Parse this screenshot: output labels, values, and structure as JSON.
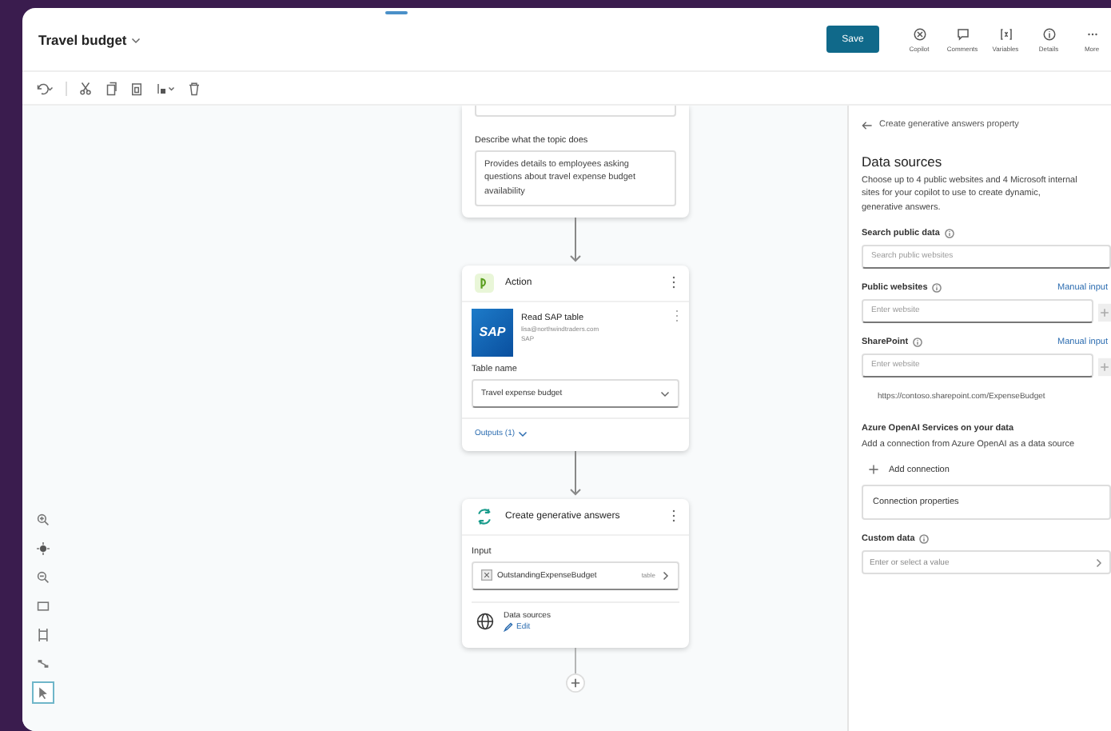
{
  "header": {
    "title": "Travel budget",
    "save": "Save",
    "tools": [
      {
        "kind": "copilot",
        "label": "Copilot"
      },
      {
        "kind": "comments",
        "label": "Comments"
      },
      {
        "kind": "variables",
        "label": "Variables"
      },
      {
        "kind": "details",
        "label": "Details"
      },
      {
        "kind": "more",
        "label": "More"
      }
    ]
  },
  "topic_card": {
    "description_label": "Describe what the topic does",
    "description": "Provides details to employees asking questions about travel expense budget availability"
  },
  "action_card": {
    "title": "Action",
    "logo": "SAP",
    "connector": "Read SAP table",
    "account": "lisa@northwindtraders.com",
    "detail": "SAP",
    "table_label": "Table name",
    "table_value": "Travel expense budget",
    "outputs": "Outputs (1)"
  },
  "generative_card": {
    "title": "Create generative answers",
    "input_label": "Input",
    "input_value": "OutstandingExpenseBudget",
    "input_type": "table",
    "data_sources": "Data sources",
    "edit": "Edit"
  },
  "canvas_tools": [
    {
      "kind": "zoom-in",
      "selected": false
    },
    {
      "kind": "center",
      "selected": false
    },
    {
      "kind": "zoom-out",
      "selected": false
    },
    {
      "kind": "fit",
      "selected": false
    },
    {
      "kind": "frame",
      "selected": false
    },
    {
      "kind": "minimap",
      "selected": false
    },
    {
      "kind": "pointer",
      "selected": true
    }
  ],
  "panel": {
    "back": "Create generative answers property",
    "heading": "Data sources",
    "description": "Choose up to 4 public websites and 4 Microsoft internal sites for your copilot to use to create dynamic, generative answers.",
    "search_label": "Search public data",
    "search_placeholder": "Search public websites",
    "public_label": "Public websites",
    "public_mode": "Manual input",
    "public_placeholder": "Enter website",
    "sharepoint_label": "SharePoint",
    "sharepoint_mode": "Manual input",
    "sharepoint_placeholder": "Enter website",
    "sharepoint_url": "https://contoso.sharepoint.com/ExpenseBudget",
    "azure_heading": "Azure OpenAI Services on your data",
    "azure_description": "Add a connection from Azure OpenAI as a data source",
    "add_connection": "Add connection",
    "connection_properties": "Connection properties",
    "custom_label": "Custom data",
    "custom_placeholder": "Enter or select a value"
  }
}
